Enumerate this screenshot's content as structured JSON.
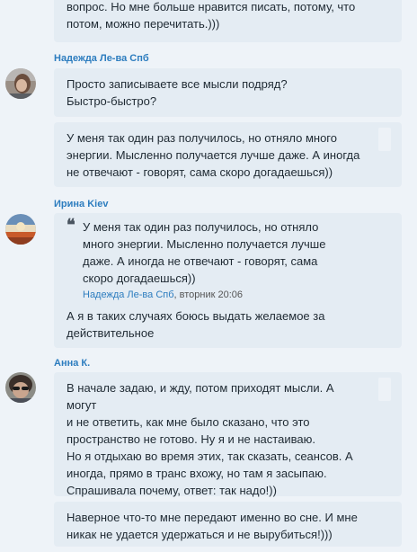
{
  "messages": {
    "m0": {
      "text": "вопрос. Но мне больше нравится писать, потому, что\nпотом, можно перечитать.)))"
    },
    "nadezhda": {
      "name": "Надежда Ле-ва Спб",
      "m1": "Просто записываете все мысли подряд?\nБыстро-быстро?",
      "m2": "У меня так один раз получилось, но отняло много\nэнергии. Мысленно получается лучше даже. А иногда\nне отвечают - говорят, сама скоро догадаешься))"
    },
    "irina": {
      "name": "Ирина Kiev",
      "quote_mark": "❝",
      "quote_text": "У меня так один раз получилось, но отняло\nмного энергии. Мысленно получается лучше\nдаже. А иногда не отвечают - говорят, сама\nскоро догадаешься))",
      "quote_author": "Надежда Ле-ва Спб",
      "quote_time": ", вторник 20:06",
      "reply": "А я в таких случаях боюсь выдать желаемое за\nдействительное"
    },
    "anna": {
      "name": "Анна К.",
      "m1": "В начале задаю, и жду, потом приходят мысли. А могут\nи не ответить, как мне было сказано, что это\nпространство не готово. Ну я и не настаиваю.\n Но я отдыхаю во время этих, так сказать, сеансов. А\nиногда, прямо в транс вхожу, но там я засыпаю.\nСпрашивала почему, ответ: так надо!))",
      "m2": "Наверное что-то мне передают именно во сне. И мне\nникак не удается удержаться и не вырубиться!)))"
    }
  },
  "colors": {
    "background": "#eef3f8",
    "bubble": "#e4ecf3",
    "name_accent": "#2d7dbf"
  }
}
